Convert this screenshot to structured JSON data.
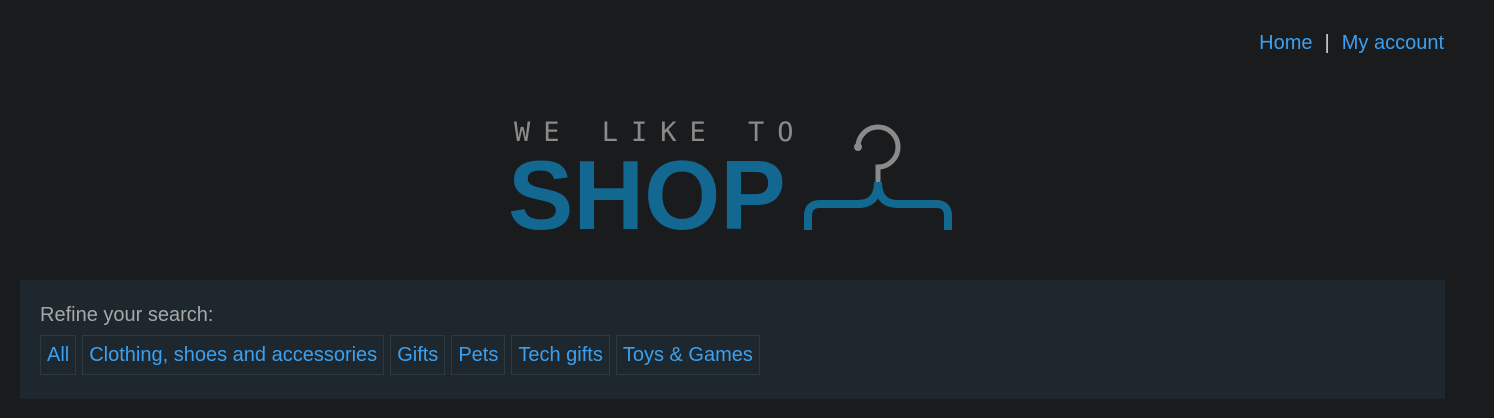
{
  "nav": {
    "home": "Home",
    "separator": "|",
    "my_account": "My account"
  },
  "logo": {
    "tagline": "WE LIKE TO",
    "word": "SHOP",
    "icon": "clothes-hanger-icon"
  },
  "filters": {
    "label": "Refine your search:",
    "items": [
      "All",
      "Clothing, shoes and accessories",
      "Gifts",
      "Pets",
      "Tech gifts",
      "Toys & Games"
    ]
  },
  "colors": {
    "background": "#1a1b1d",
    "panel": "#1d272d",
    "link": "#3ba0f0",
    "logo_blue": "#136891",
    "logo_gray": "#8a8a8a"
  }
}
